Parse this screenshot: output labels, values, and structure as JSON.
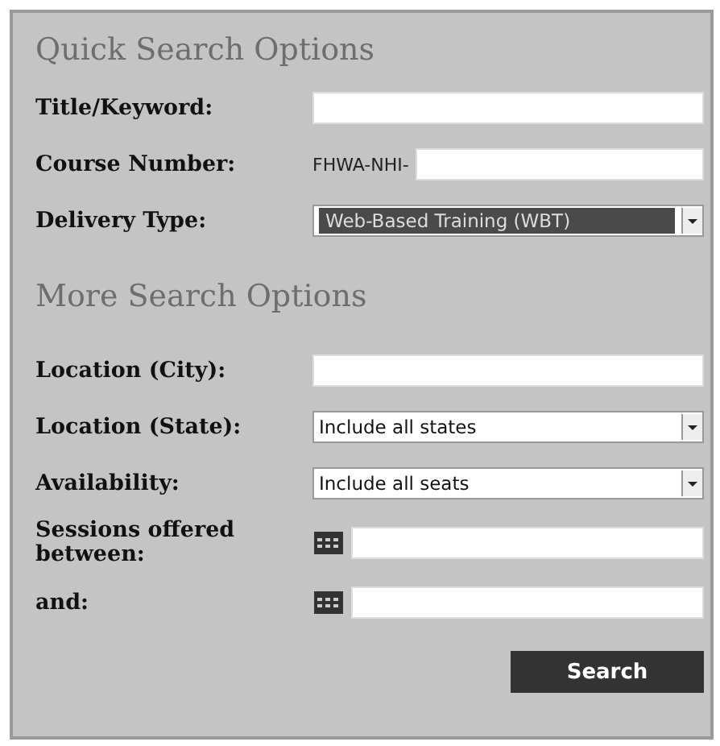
{
  "sections": [
    {
      "heading": "Quick Search Options",
      "fields": [
        {
          "kind": "text",
          "label": "Title/Keyword:"
        },
        {
          "kind": "prefixed",
          "label": "Course Number:",
          "prefix": "FHWA-NHI-"
        },
        {
          "kind": "select",
          "label": "Delivery Type:",
          "value": "Web-Based Training (WBT)",
          "highlighted": true
        }
      ]
    },
    {
      "heading": "More Search Options",
      "fields": [
        {
          "kind": "text",
          "label": "Location (City):"
        },
        {
          "kind": "select",
          "label": "Location (State):",
          "value": "Include all states",
          "highlighted": false
        },
        {
          "kind": "select",
          "label": "Availability:",
          "value": "Include all seats",
          "highlighted": false
        },
        {
          "kind": "date",
          "label": "Sessions offered between:"
        },
        {
          "kind": "date",
          "label": "and:"
        }
      ]
    }
  ],
  "search_button": "Search"
}
